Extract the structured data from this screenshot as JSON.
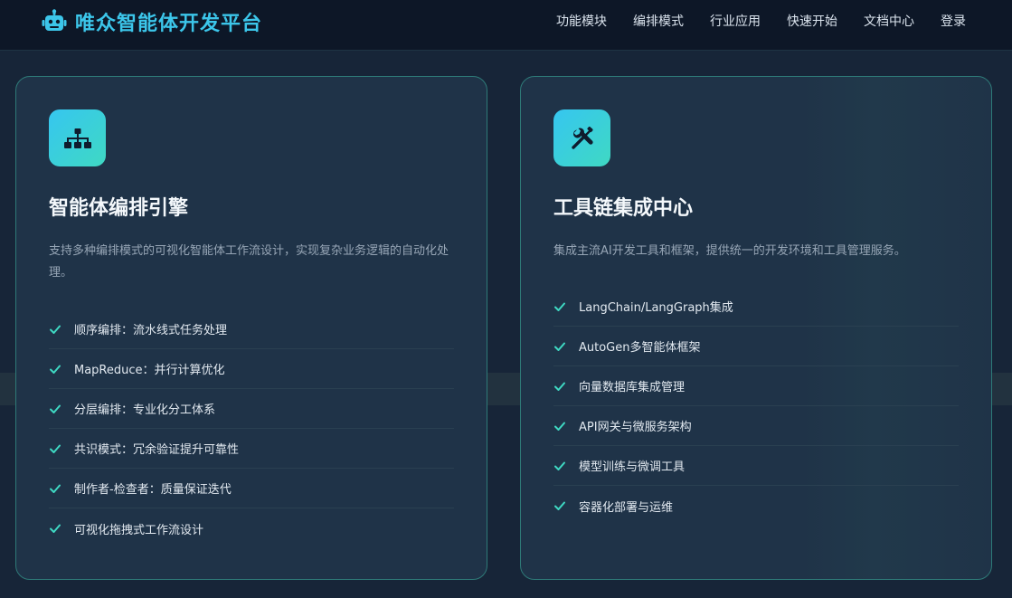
{
  "header": {
    "brand": {
      "name": "唯众智能体开发平台",
      "icon": "robot-icon"
    },
    "nav": [
      {
        "label": "功能模块"
      },
      {
        "label": "编排模式"
      },
      {
        "label": "行业应用"
      },
      {
        "label": "快速开始"
      },
      {
        "label": "文档中心"
      },
      {
        "label": "登录"
      }
    ]
  },
  "colors": {
    "brand": "#3cc6ea",
    "accent_check": "#3fd9c3",
    "icon_gradient_start": "#36c6f0",
    "icon_gradient_end": "#3fd9c3",
    "card_border": "#2e7a78",
    "page_background": "#172538",
    "header_background": "#0d1727"
  },
  "cards": [
    {
      "icon": "sitemap-icon",
      "title": "智能体编排引擎",
      "description": "支持多种编排模式的可视化智能体工作流设计，实现复杂业务逻辑的自动化处理。",
      "features": [
        {
          "label": "顺序编排：流水线式任务处理",
          "icon": "check-icon"
        },
        {
          "label": "MapReduce：并行计算优化",
          "icon": "check-icon"
        },
        {
          "label": "分层编排：专业化分工体系",
          "icon": "check-icon"
        },
        {
          "label": "共识模式：冗余验证提升可靠性",
          "icon": "check-icon"
        },
        {
          "label": "制作者-检查者：质量保证迭代",
          "icon": "check-icon"
        },
        {
          "label": "可视化拖拽式工作流设计",
          "icon": "check-icon"
        }
      ]
    },
    {
      "icon": "tools-icon",
      "title": "工具链集成中心",
      "description": "集成主流AI开发工具和框架，提供统一的开发环境和工具管理服务。",
      "features": [
        {
          "label": "LangChain/LangGraph集成",
          "icon": "check-icon"
        },
        {
          "label": "AutoGen多智能体框架",
          "icon": "check-icon"
        },
        {
          "label": "向量数据库集成管理",
          "icon": "check-icon"
        },
        {
          "label": "API网关与微服务架构",
          "icon": "check-icon"
        },
        {
          "label": "模型训练与微调工具",
          "icon": "check-icon"
        },
        {
          "label": "容器化部署与运维",
          "icon": "check-icon"
        }
      ]
    }
  ]
}
